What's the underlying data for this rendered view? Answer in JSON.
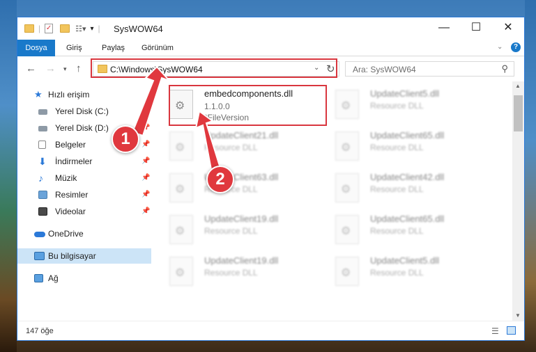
{
  "window": {
    "title": "SysWOW64"
  },
  "window_controls": {
    "minimize": "—",
    "maximize": "☐",
    "close": "✕"
  },
  "ribbon": {
    "tabs": [
      "Dosya",
      "Giriş",
      "Paylaş",
      "Görünüm"
    ]
  },
  "address": {
    "path": "C:\\Windows\\SysWOW64",
    "refresh_icon": "↻"
  },
  "search": {
    "placeholder": "Ara: SysWOW64"
  },
  "sidebar": {
    "quick_access": "Hızlı erişim",
    "items": [
      {
        "label": "Yerel Disk (C:)",
        "icon": "drive-icon",
        "pinned": true
      },
      {
        "label": "Yerel Disk (D:)",
        "icon": "drive-icon",
        "pinned": true
      },
      {
        "label": "Belgeler",
        "icon": "documents-icon",
        "pinned": true
      },
      {
        "label": "İndirmeler",
        "icon": "downloads-icon",
        "pinned": true
      },
      {
        "label": "Müzik",
        "icon": "music-icon",
        "pinned": true
      },
      {
        "label": "Resimler",
        "icon": "pictures-icon",
        "pinned": true
      },
      {
        "label": "Videolar",
        "icon": "videos-icon",
        "pinned": true
      }
    ],
    "onedrive": "OneDrive",
    "this_pc": "Bu bilgisayar",
    "network": "Ağ"
  },
  "files": [
    {
      "name": "embedcomponents.dll",
      "line2": "1.1.0.0",
      "line3": "*FileVersion",
      "highlight": true
    },
    {
      "name": "UpdateClient5.dll",
      "line2": "Resource DLL"
    },
    {
      "name": "UpdateClient21.dll",
      "line2": "Resource DLL"
    },
    {
      "name": "UpdateClient65.dll",
      "line2": "Resource DLL"
    },
    {
      "name": "UpdateClient63.dll",
      "line2": "Resource DLL"
    },
    {
      "name": "UpdateClient42.dll",
      "line2": "Resource DLL"
    },
    {
      "name": "UpdateClient19.dll",
      "line2": "Resource DLL"
    },
    {
      "name": "UpdateClient65.dll",
      "line2": "Resource DLL"
    },
    {
      "name": "UpdateClient19.dll",
      "line2": "Resource DLL"
    },
    {
      "name": "UpdateClient5.dll",
      "line2": "Resource DLL"
    }
  ],
  "status": {
    "count": "147 öğe"
  },
  "annotations": {
    "marker1": "1",
    "marker2": "2"
  },
  "colors": {
    "accent": "#1979ca",
    "highlight_red": "#d9363e",
    "selection": "#cce4f7"
  }
}
